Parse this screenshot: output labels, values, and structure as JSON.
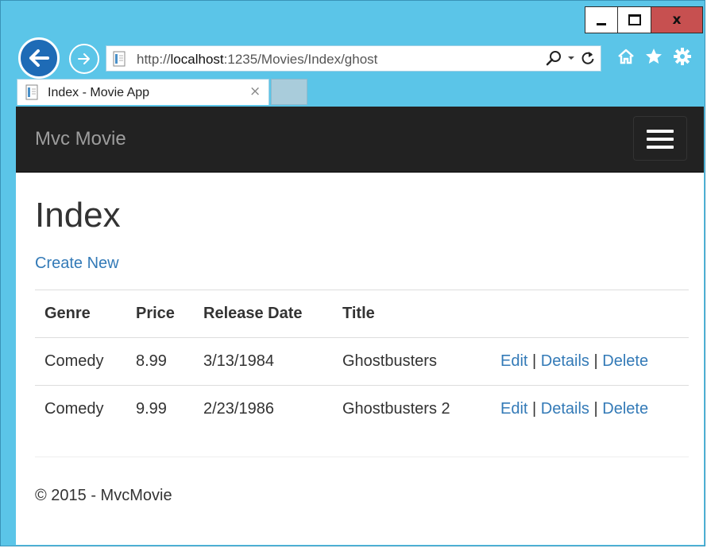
{
  "window": {
    "controls": [
      "minimize",
      "maximize",
      "close"
    ]
  },
  "browser": {
    "address": {
      "url_prefix": "http://",
      "url_host": "localhost",
      "url_rest": ":1235/Movies/Index/ghost"
    },
    "icons": [
      "back-arrow-icon",
      "forward-arrow-icon",
      "search-icon",
      "refresh-icon",
      "home-icon",
      "favorites-star-icon",
      "gear-icon"
    ],
    "tab": {
      "title": "Index - Movie App"
    }
  },
  "navbar": {
    "brand": "Mvc Movie"
  },
  "page": {
    "title": "Index",
    "create_link": "Create New"
  },
  "table": {
    "headers": [
      "Genre",
      "Price",
      "Release Date",
      "Title",
      ""
    ],
    "rows": [
      {
        "genre": "Comedy",
        "price": "8.99",
        "release_date": "3/13/1984",
        "title": "Ghostbusters"
      },
      {
        "genre": "Comedy",
        "price": "9.99",
        "release_date": "2/23/1986",
        "title": "Ghostbusters 2"
      }
    ],
    "actions": {
      "edit": "Edit",
      "details": "Details",
      "delete": "Delete",
      "separator": "|"
    }
  },
  "footer": {
    "text": "© 2015 - MvcMovie"
  },
  "colors": {
    "chrome": "#5bc5e8",
    "navbar": "#222222",
    "link": "#337ab7",
    "close_button": "#c75050"
  }
}
